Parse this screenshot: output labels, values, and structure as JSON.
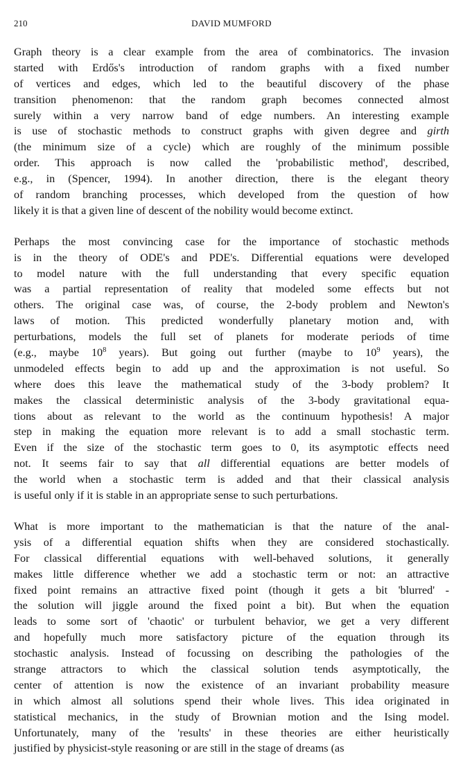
{
  "header": {
    "page_number": "210",
    "running_title": "DAVID MUMFORD"
  },
  "paragraphs": [
    [
      [
        "Graph theory is a clear example from the area of combinatorics. The invasion"
      ],
      [
        "started with Erdős's introduction of random graphs with a fixed number"
      ],
      [
        "of vertices and edges, which led to the beautiful discovery of the phase"
      ],
      [
        "transition phenomenon: that the random graph becomes connected almost"
      ],
      [
        "surely within a very narrow band of edge numbers. An interesting example"
      ],
      [
        "is use of stochastic methods to construct graphs with given degree and ",
        {
          "i": "girth"
        }
      ],
      [
        "(the minimum size of a cycle) which are roughly of the minimum possible"
      ],
      [
        "order. This approach is now called the 'probabilistic method', described,"
      ],
      [
        "e.g., in (Spencer, 1994). In another direction, there is the elegant theory"
      ],
      [
        "of random branching processes, which developed from the question of how"
      ],
      [
        "likely it is that a given line of descent of the nobility would become extinct."
      ]
    ],
    [
      [
        "Perhaps the most convincing case for the importance of stochastic methods"
      ],
      [
        "is in the theory of ODE's and PDE's. Differential equations were developed"
      ],
      [
        "to model nature with the full understanding that every specific equation"
      ],
      [
        "was a partial representation of reality that modeled some effects but not"
      ],
      [
        "others. The original case was, of course, the 2-body problem and Newton's"
      ],
      [
        "laws of motion. This predicted wonderfully planetary motion and, with"
      ],
      [
        "perturbations, models the full set of planets for moderate periods of time"
      ],
      [
        "(e.g., maybe 10",
        {
          "sup": "8"
        },
        " years). But going out further (maybe to 10",
        {
          "sup": "9"
        },
        " years), the"
      ],
      [
        "unmodeled effects begin to add up and the approximation is not useful. So"
      ],
      [
        "where does this leave the mathematical study of the 3-body problem? It"
      ],
      [
        "makes the classical deterministic analysis of the 3-body gravitational equa-"
      ],
      [
        "tions about as relevant to the world as the continuum hypothesis! A major"
      ],
      [
        "step in making the equation more relevant is to add a small stochastic term."
      ],
      [
        "Even if the size of the stochastic term goes to 0, its asymptotic effects need"
      ],
      [
        "not. It seems fair to say that ",
        {
          "i": "all"
        },
        " differential equations are better models of"
      ],
      [
        "the world when a stochastic term is added and that their classical analysis"
      ],
      [
        "is useful only if it is stable in an appropriate sense to such perturbations."
      ]
    ],
    [
      [
        "What is more important to the mathematician is that the nature of the anal-"
      ],
      [
        "ysis of a differential equation shifts when they are considered stochastically."
      ],
      [
        "For classical differential equations with well-behaved solutions, it generally"
      ],
      [
        "makes little difference whether we add a stochastic term or not: an attractive"
      ],
      [
        "fixed point remains an attractive fixed point (though it gets a bit 'blurred' -"
      ],
      [
        "the solution will jiggle around the fixed point a bit). But when the equation"
      ],
      [
        "leads to some sort of 'chaotic' or turbulent behavior, we get a very different"
      ],
      [
        "and hopefully much more satisfactory picture of the equation through its"
      ],
      [
        "stochastic analysis. Instead of focussing on describing the pathologies of the"
      ],
      [
        "strange attractors to which the classical solution tends asymptotically, the"
      ],
      [
        "center of attention is now the existence of an invariant probability measure"
      ],
      [
        "in which almost all solutions spend their whole lives. This idea originated in"
      ],
      [
        "statistical mechanics, in the study of Brownian motion and the Ising model."
      ],
      [
        "Unfortunately, many of the 'results' in these theories are either heuristically"
      ],
      [
        "justified by physicist-style reasoning or are still in the stage of dreams (as"
      ]
    ]
  ]
}
